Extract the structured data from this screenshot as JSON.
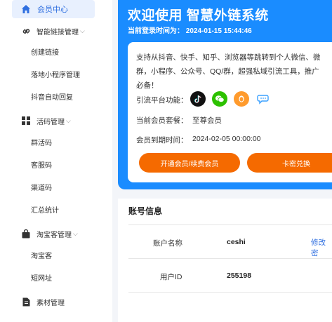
{
  "sidebar": {
    "active": "会员中心",
    "groups": [
      {
        "label": "智能链接管理",
        "items": [
          "创建链接",
          "落地小程序管理",
          "抖音自动回复"
        ]
      },
      {
        "label": "活码管理",
        "items": [
          "群活码",
          "客服码",
          "渠道码",
          "汇总统计"
        ]
      },
      {
        "label": "淘宝客管理",
        "items": [
          "淘宝客",
          "短网址"
        ]
      }
    ],
    "material": "素材管理"
  },
  "hero": {
    "title": "欢迎使用 智慧外链系统",
    "login_time": "当前登录时间为： 2024-01-15 15:44:46"
  },
  "card": {
    "intro_line1": "支持从抖音、快手、知乎、浏览器等跳转到个人微信、微",
    "intro_line2": "群，小程序、公众号、QQ/群，超强私域引流工具，推广",
    "intro_line3": "必备！",
    "platform_label": "引流平台功能：",
    "platform_icons": [
      "tiktok-icon",
      "wechat-icon",
      "qq-icon",
      "chat-bubble-icon"
    ],
    "package_label": "当前会员套餐：",
    "package_value": "至尊会员",
    "expire_label": "会员到期时间：",
    "expire_value": "2024-02-05 00:00:00",
    "btn_open": "开通会员/续费会员",
    "btn_card": "卡密兑换"
  },
  "account": {
    "title": "账号信息",
    "rows": [
      {
        "label": "账户名称",
        "value": "ceshi",
        "action": "修改密"
      },
      {
        "label": "用户ID",
        "value": "255198"
      }
    ]
  },
  "colors": {
    "primary": "#1a8cff",
    "accent": "#f56a00",
    "active_bg": "#e8f0fe"
  }
}
